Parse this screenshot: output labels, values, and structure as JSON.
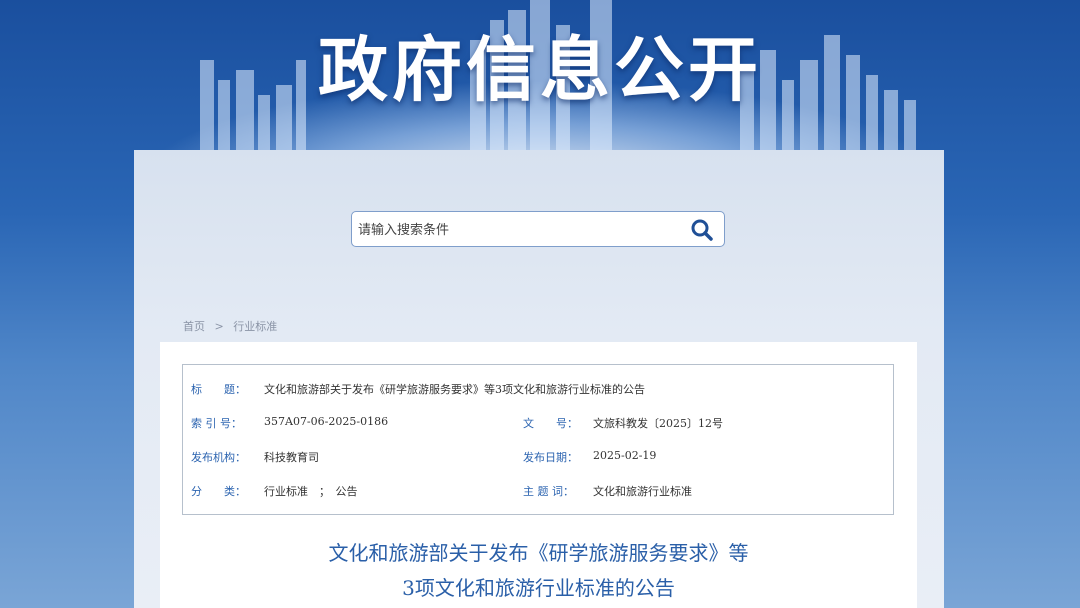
{
  "banner": {
    "title": "政府信息公开"
  },
  "search": {
    "placeholder": "请输入搜索条件",
    "icon": "search-icon"
  },
  "breadcrumb": {
    "home": "首页",
    "separator": ">",
    "current": "行业标准"
  },
  "meta": {
    "title_label": "标　　题：",
    "title_value": "文化和旅游部关于发布《研学旅游服务要求》等3项文化和旅游行业标准的公告",
    "index_label": "索 引 号：",
    "index_value": "357A07-06-2025-0186",
    "docno_label": "文　　号：",
    "docno_value": "文旅科教发〔2025〕12号",
    "org_label": "发布机构：",
    "org_value": "科技教育司",
    "date_label": "发布日期：",
    "date_value": "2025-02-19",
    "category_label": "分　　类：",
    "category_value": "行业标准　；　公告",
    "topic_label": "主 题 词：",
    "topic_value": "文化和旅游行业标准"
  },
  "article": {
    "title_line1": "文化和旅游部关于发布《研学旅游服务要求》等",
    "title_line2": "3项文化和旅游行业标准的公告"
  },
  "colors": {
    "label_blue": "#2c64b0",
    "title_blue": "#2a5fa8",
    "banner_blue": "#1a4f9e"
  }
}
